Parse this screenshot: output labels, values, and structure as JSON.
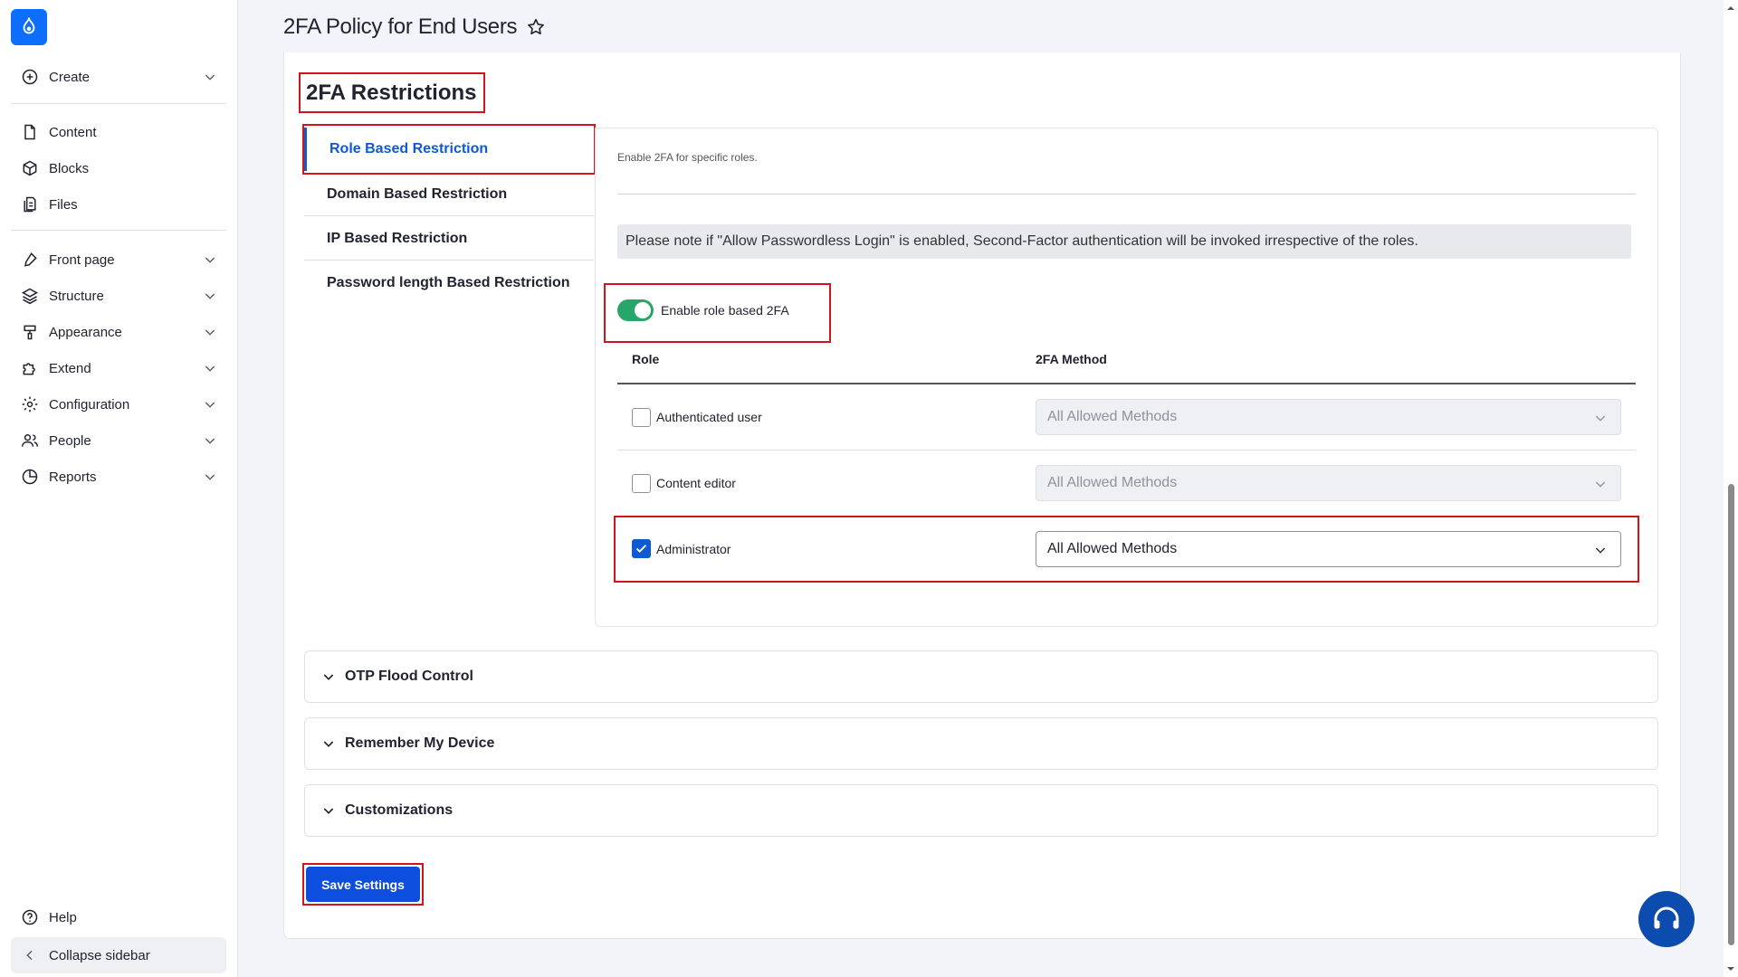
{
  "page": {
    "title": "2FA Policy for End Users"
  },
  "sidebar": {
    "create": "Create",
    "items": [
      {
        "label": "Content",
        "icon": "file-icon"
      },
      {
        "label": "Blocks",
        "icon": "cube-icon"
      },
      {
        "label": "Files",
        "icon": "files-icon"
      }
    ],
    "menus": [
      {
        "label": "Front page",
        "icon": "brush-icon"
      },
      {
        "label": "Structure",
        "icon": "layers-icon"
      },
      {
        "label": "Appearance",
        "icon": "paint-icon"
      },
      {
        "label": "Extend",
        "icon": "puzzle-icon"
      },
      {
        "label": "Configuration",
        "icon": "gear-icon"
      },
      {
        "label": "People",
        "icon": "people-icon"
      },
      {
        "label": "Reports",
        "icon": "chart-pie-icon"
      }
    ],
    "help": "Help",
    "collapse": "Collapse sidebar"
  },
  "restrictions": {
    "title": "2FA Restrictions",
    "tabs": [
      "Role Based Restriction",
      "Domain Based Restriction",
      "IP Based Restriction",
      "Password length Based Restriction"
    ],
    "description": "Enable 2FA for specific roles.",
    "note": "Please note if \"Allow Passwordless Login\" is enabled, Second-Factor authentication will be invoked irrespective of the roles.",
    "toggle_label": "Enable role based 2FA",
    "toggle_on": true,
    "columns": {
      "role": "Role",
      "method": "2FA Method"
    },
    "rows": [
      {
        "role": "Authenticated user",
        "checked": false,
        "method": "All Allowed Methods"
      },
      {
        "role": "Content editor",
        "checked": false,
        "method": "All Allowed Methods"
      },
      {
        "role": "Administrator",
        "checked": true,
        "method": "All Allowed Methods"
      }
    ]
  },
  "accordions": [
    "OTP Flood Control",
    "Remember My Device",
    "Customizations"
  ],
  "save_label": "Save Settings",
  "colors": {
    "accent": "#0d5ad3",
    "highlight": "#d4141c",
    "toggle": "#26a769"
  }
}
